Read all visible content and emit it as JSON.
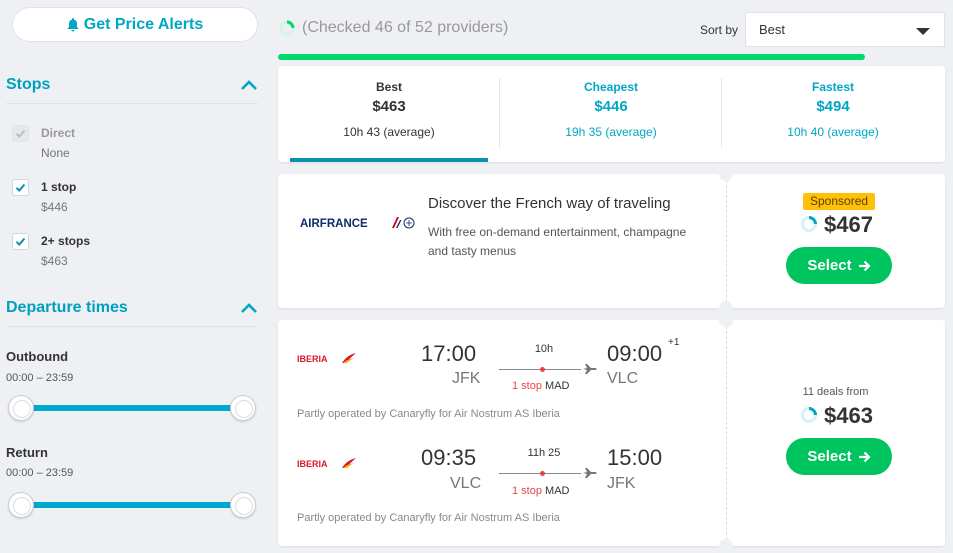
{
  "alerts_button": {
    "label": "Get Price Alerts"
  },
  "filters": {
    "stops": {
      "title": "Stops",
      "options": [
        {
          "label": "Direct",
          "sub": "None",
          "checked": true,
          "disabled": true
        },
        {
          "label": "1 stop",
          "sub": "$446",
          "checked": true,
          "disabled": false
        },
        {
          "label": "2+ stops",
          "sub": "$463",
          "checked": true,
          "disabled": false
        }
      ]
    },
    "departure_times": {
      "title": "Departure times",
      "outbound": {
        "label": "Outbound",
        "range": "00:00 – 23:59"
      },
      "return": {
        "label": "Return",
        "range": "00:00 – 23:59"
      }
    }
  },
  "status": {
    "checked_text": "(Checked 46 of 52 providers)",
    "progress": 0.885
  },
  "sort": {
    "label": "Sort by",
    "value": "Best"
  },
  "tabs": [
    {
      "name": "Best",
      "price": "$463",
      "duration": "10h 43 (average)",
      "active": true
    },
    {
      "name": "Cheapest",
      "price": "$446",
      "duration": "19h 35 (average)",
      "active": false
    },
    {
      "name": "Fastest",
      "price": "$494",
      "duration": "10h 40 (average)",
      "active": false
    }
  ],
  "ad": {
    "airline": "AIRFRANCE",
    "title": "Discover the French way of traveling",
    "description": "With free on-demand entertainment, champagne and tasty menus",
    "badge": "Sponsored",
    "price": "$467",
    "select_label": "Select"
  },
  "result": {
    "legs": [
      {
        "airline": "IBERIA",
        "depart_time": "17:00",
        "depart_code": "JFK",
        "duration": "10h",
        "stops": "1 stop",
        "via": "MAD",
        "arrive_time": "09:00",
        "arrive_code": "VLC",
        "day_offset": "+1",
        "operated_by": "Partly operated by Canaryfly for Air Nostrum AS Iberia"
      },
      {
        "airline": "IBERIA",
        "depart_time": "09:35",
        "depart_code": "VLC",
        "duration": "11h 25",
        "stops": "1 stop",
        "via": "MAD",
        "arrive_time": "15:00",
        "arrive_code": "JFK",
        "day_offset": "",
        "operated_by": "Partly operated by Canaryfly for Air Nostrum AS Iberia"
      }
    ],
    "deals": "11 deals from",
    "price": "$463",
    "select_label": "Select"
  },
  "colors": {
    "accent": "#00a7c4",
    "green": "#00c45e",
    "stop_red": "#e64545",
    "sponsored": "#ffc107"
  }
}
